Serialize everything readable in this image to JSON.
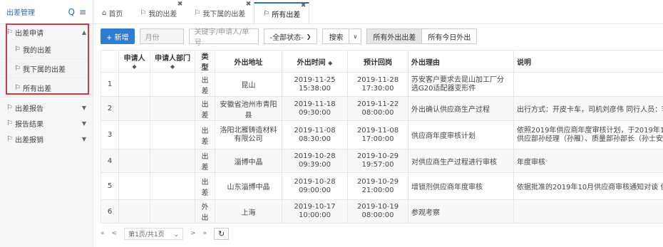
{
  "sidebar": {
    "title": "出差管理",
    "search_icon": "Q",
    "menu_icon": "≡",
    "groups": [
      {
        "label": "出差申请",
        "expanded": true
      },
      {
        "label": "出差报告"
      },
      {
        "label": "报告结果"
      },
      {
        "label": "出差报销"
      }
    ],
    "sub_items": [
      "我的出差",
      "我下属的出差",
      "所有出差"
    ]
  },
  "tabs": [
    {
      "label": "首页",
      "icon": "home-icon"
    },
    {
      "label": "我的出差"
    },
    {
      "label": "我下属的出差"
    },
    {
      "label": "所有出差",
      "active": true
    }
  ],
  "toolbar": {
    "new_label": "+ 新增",
    "month_placeholder": "月份",
    "keyword_placeholder": "关键字/申请人/单号",
    "status_value": "-全部状态-",
    "search_label": "搜索",
    "toggle_all_out": "所有外出出差",
    "toggle_today_out": "所有今日外出"
  },
  "table": {
    "headers": [
      "",
      "申请人",
      "申请人部门",
      "类型",
      "外出地址",
      "外出时间",
      "预计回岗",
      "外出理由",
      "说明"
    ],
    "sort_mark": "◆",
    "rows": [
      {
        "no": "1",
        "applicant": "",
        "dept": "",
        "type": "出差",
        "addr": "昆山",
        "out_time": [
          "2019-11-25",
          "15:38:00"
        ],
        "return_time": [
          "2019-11-28",
          "17:30:00"
        ],
        "reason": "苏安客户要求去昆山加工厂分选G20适配器变形件",
        "desc": ""
      },
      {
        "no": "2",
        "applicant": "",
        "dept": "",
        "type": "出差",
        "addr": "安徽省池州市青阳县",
        "out_time": [
          "2019-11-18",
          "09:30:00"
        ],
        "return_time": [
          "2019-11-22",
          "08:00:00"
        ],
        "reason": "外出确认供应商生产过程",
        "desc": "出行方式：开皮卡车，司机刘彦伟 同行人员：李晓东"
      },
      {
        "no": "3",
        "applicant": "",
        "dept": "",
        "type": "出差",
        "addr": "洛阳北雁铸造材料有限公司",
        "out_time": [
          "2019-11-08",
          "08:30:00"
        ],
        "return_time": [
          "2019-11-08",
          "17:00:00"
        ],
        "reason": "供应商年度审核计划",
        "desc": [
          "依照2019年供应商年度审核计划，于2019年11月8日（周",
          "供应部孙经理（孙雁）、质量部孙部长（孙士安）、SQE"
        ]
      },
      {
        "no": "4",
        "applicant": "",
        "dept": "",
        "type": "出差",
        "addr": "淄博中晶",
        "out_time": [
          "2019-10-28",
          "09:39:00"
        ],
        "return_time": [
          "2019-10-29",
          "19:57:00"
        ],
        "reason": "对供应商生产过程进行审核",
        "desc": "年度审核"
      },
      {
        "no": "5",
        "applicant": "",
        "dept": "",
        "type": "出差",
        "addr": "山东淄博中晶",
        "out_time": [
          "2019-10-28",
          "09:00:00"
        ],
        "return_time": [
          "2019-10-29",
          "21:00:00"
        ],
        "reason": "增锁剂供应商年度审核",
        "desc": "依据批准的2019年10月供应商审核通知对谈 供应商进行环"
      },
      {
        "no": "6",
        "applicant": "",
        "dept": "",
        "type": "外出",
        "addr": "上海",
        "out_time": [
          "2019-10-17",
          "10:00:00"
        ],
        "return_time": [
          "2019-10-19",
          "08:00:00"
        ],
        "reason": "参观考察",
        "desc": ""
      }
    ]
  },
  "pager": {
    "first": "«",
    "prev": "<",
    "info": "第1页/共1页",
    "next": ">",
    "last": "»",
    "refresh_icon": "↻"
  }
}
